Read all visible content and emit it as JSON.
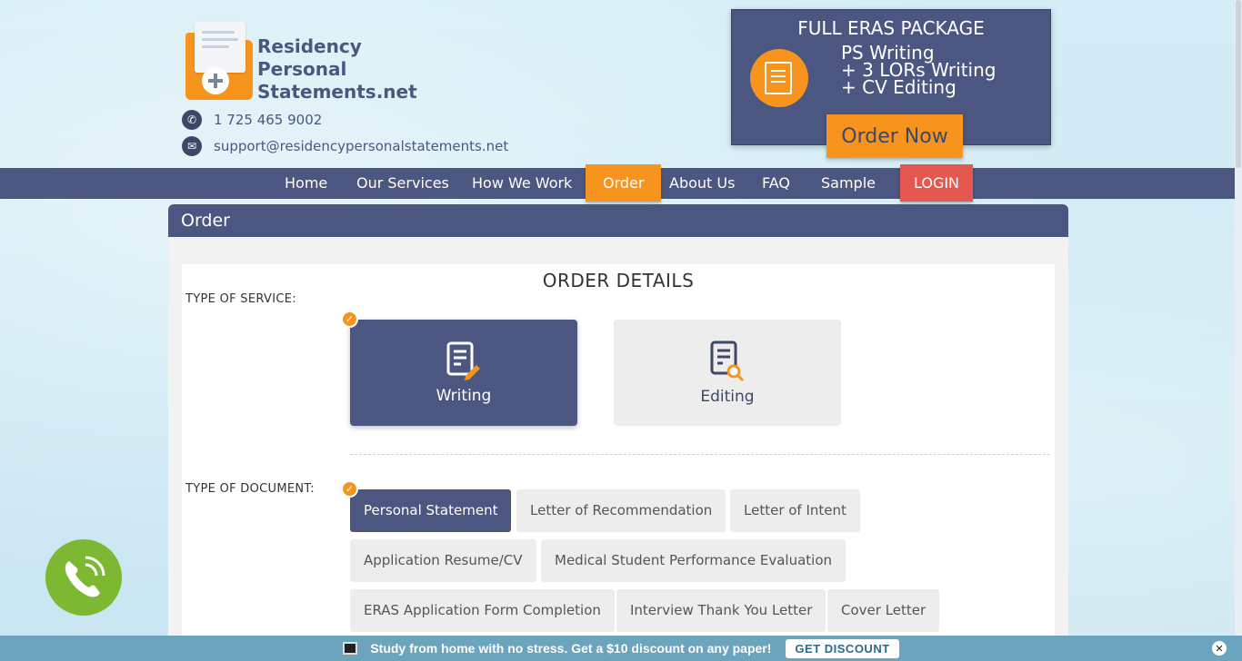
{
  "brand": {
    "name_lines": [
      "Residency",
      "Personal",
      "Statements.net"
    ],
    "phone": "1 725 465 9002",
    "email": "support@residencypersonalstatements.net"
  },
  "eras": {
    "title": "FULL ERAS PACKAGE",
    "lines": [
      "PS Writing",
      "+ 3 LORs Writing",
      "+ CV Editing"
    ],
    "cta": "Order Now"
  },
  "nav": {
    "items": [
      "Home",
      "Our Services",
      "How We Work",
      "Order",
      "About Us",
      "FAQ",
      "Sample"
    ],
    "login": "LOGIN",
    "active": "Order"
  },
  "panel": {
    "title": "Order",
    "heading": "ORDER DETAILS",
    "service_label": "TYPE OF SERVICE:",
    "services": [
      "Writing",
      "Editing"
    ],
    "selected_service": "Writing",
    "document_label": "TYPE OF DOCUMENT:",
    "documents": [
      "Personal Statement",
      "Letter of Recommendation",
      "Letter of Intent",
      "Application Resume/CV",
      "Medical Student Performance Evaluation",
      "ERAS Application Form Completion",
      "Interview Thank You Letter",
      "Cover Letter"
    ],
    "selected_document": "Personal Statement"
  },
  "promo": {
    "text": "Study from home with no stress. Get a $10 discount on any paper!",
    "button": "GET DISCOUNT",
    "close": "✕"
  },
  "icons": {
    "phone": "phone-icon",
    "email": "envelope-icon",
    "call": "phone-call-icon",
    "writing": "document-pen-icon",
    "editing": "document-search-icon",
    "check": "checkmark-icon"
  },
  "colors": {
    "navy": "#4b5780",
    "orange": "#f7941d",
    "red": "#e4584f",
    "green": "#7cb831",
    "promo": "#6ca3bd"
  }
}
